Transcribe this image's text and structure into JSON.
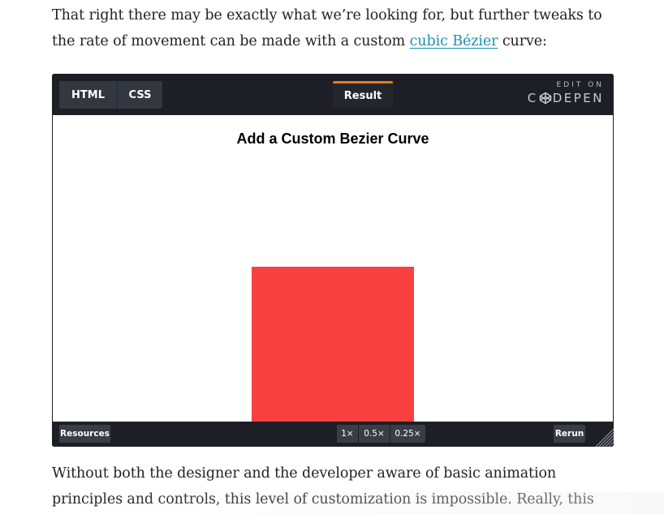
{
  "article": {
    "para_top_before": "That right there may be exactly what we’re looking for, but further tweaks to the rate of movement can be made with a custom ",
    "para_top_link": "cubic Bézier",
    "para_top_after": " curve:",
    "para_bottom": "Without both the designer and the developer aware of basic animation principles and controls, this level of customization is impossible. Really, this article just scratches the"
  },
  "embed": {
    "tabs": {
      "html": "HTML",
      "css": "CSS",
      "result": "Result"
    },
    "codepen": {
      "edit_on": "EDIT ON",
      "logo_pre": "C",
      "logo_post": "DEPEN"
    },
    "result": {
      "title": "Add a Custom Bezier Curve"
    },
    "footer": {
      "resources": "Resources",
      "zoom": [
        "1×",
        "0.5×",
        "0.25×"
      ],
      "rerun": "Rerun"
    },
    "colors": {
      "box": "#f94040",
      "active_tab_accent": "#e07c24",
      "link": "#1a8fb4"
    }
  }
}
